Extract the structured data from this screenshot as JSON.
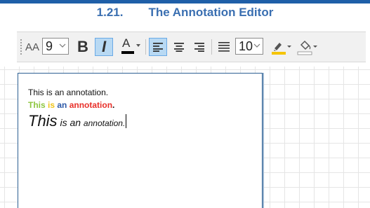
{
  "heading": {
    "number": "1.21.",
    "title": "The Annotation Editor"
  },
  "toolbar": {
    "font_size_toggle_label": "AA",
    "font_size_value": "9",
    "bold_label": "B",
    "italic_label": "I",
    "font_color_label": "A",
    "line_spacing_value": "10",
    "colors": {
      "font_color": "#000000",
      "highlight_color": "#f5c400",
      "fill_color": "#ffffff",
      "active_button_bg": "#b8d9f3"
    }
  },
  "annotation": {
    "line1": "This is an annotation.",
    "line2_parts": [
      {
        "text": "This",
        "color": "#8dc63f"
      },
      {
        "text": " is ",
        "color": "#f0c419"
      },
      {
        "text": "an ",
        "color": "#2e5aa8"
      },
      {
        "text": "annotation",
        "color": "#e8302a"
      },
      {
        "text": ".",
        "color": "#111111"
      }
    ],
    "line3_parts": [
      {
        "text": "This"
      },
      {
        "text": " is an "
      },
      {
        "text": "annotation."
      }
    ]
  }
}
